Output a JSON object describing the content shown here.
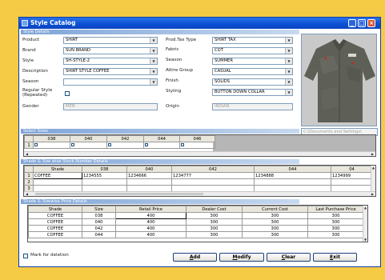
{
  "window": {
    "title": "Style Catalog"
  },
  "sections": {
    "style_details": "Style Details",
    "select_sizes": "Select Sizes",
    "stock": "Shade & Size wise Stock Number Details",
    "price": "Shade & Sizewise Price Details"
  },
  "form": {
    "product": {
      "label": "Product",
      "value": "SHIRT"
    },
    "brand": {
      "label": "Brand",
      "value": "SUN BRAND"
    },
    "style": {
      "label": "Style",
      "value": "SH-STYLE-2"
    },
    "description": {
      "label": "Description",
      "value": "SHIRT STYLE COFFEE"
    },
    "season_left": {
      "label": "Season",
      "value": ""
    },
    "regular_style": {
      "label_1": "Regular Style",
      "label_2": "(Repeated)",
      "checked": false
    },
    "gender": {
      "label": "Gender",
      "value": "MEN"
    },
    "prod_tax_type": {
      "label": "Prod.Tax Type",
      "value": "SHIRT TAX"
    },
    "fabric": {
      "label": "Fabric",
      "value": "COT"
    },
    "season_right": {
      "label": "Season",
      "value": "SUMMER"
    },
    "attire_group": {
      "label": "Attire Group",
      "value": "CASUAL"
    },
    "finish": {
      "label": "Finish",
      "value": "SOLIDS"
    },
    "styling": {
      "label": "Styling",
      "value": "BUTTON DOWN COLLAR"
    },
    "origin": {
      "label": "Origin",
      "value": "INDIAN"
    }
  },
  "image_path": "C:\\Documents and Settings\\",
  "sizes_grid": {
    "columns": [
      "038",
      "040",
      "042",
      "044",
      "046"
    ],
    "row_label": "1"
  },
  "stock_grid": {
    "columns": [
      "Shade",
      "038",
      "040",
      "042",
      "044",
      "04"
    ],
    "rows": [
      {
        "n": "1",
        "cells": [
          "COFFEE",
          "1234555",
          "1234666",
          "1234777",
          "1234888",
          "1234999"
        ]
      },
      {
        "n": "2",
        "cells": [
          "",
          "",
          "",
          "",
          "",
          ""
        ]
      },
      {
        "n": "3",
        "cells": [
          "",
          "",
          "",
          "",
          "",
          ""
        ]
      }
    ]
  },
  "price_grid": {
    "columns": [
      "Shade",
      "Size",
      "Retail Price",
      "Dealer Cost",
      "Current Cost",
      "Last Purchase Price"
    ],
    "rows": [
      [
        "COFFEE",
        "038",
        "400",
        "300",
        "300",
        "300"
      ],
      [
        "COFFEE",
        "040",
        "400",
        "300",
        "300",
        "300"
      ],
      [
        "COFFEE",
        "042",
        "400",
        "300",
        "300",
        "300"
      ],
      [
        "COFFEE",
        "044",
        "400",
        "300",
        "300",
        "300"
      ]
    ]
  },
  "mark_for_deletion": {
    "label": "Mark for deletion",
    "checked": false
  },
  "buttons": {
    "add": {
      "u": "A",
      "rest": "dd"
    },
    "modify": {
      "u": "M",
      "rest": "odify"
    },
    "clear": {
      "u": "C",
      "rest": "lear"
    },
    "exit": {
      "u": "E",
      "rest": "xit"
    }
  },
  "colors": {
    "titlebar": "#0b4fd2",
    "section_bar": "#7ea4d8",
    "background": "#f5ca45"
  }
}
